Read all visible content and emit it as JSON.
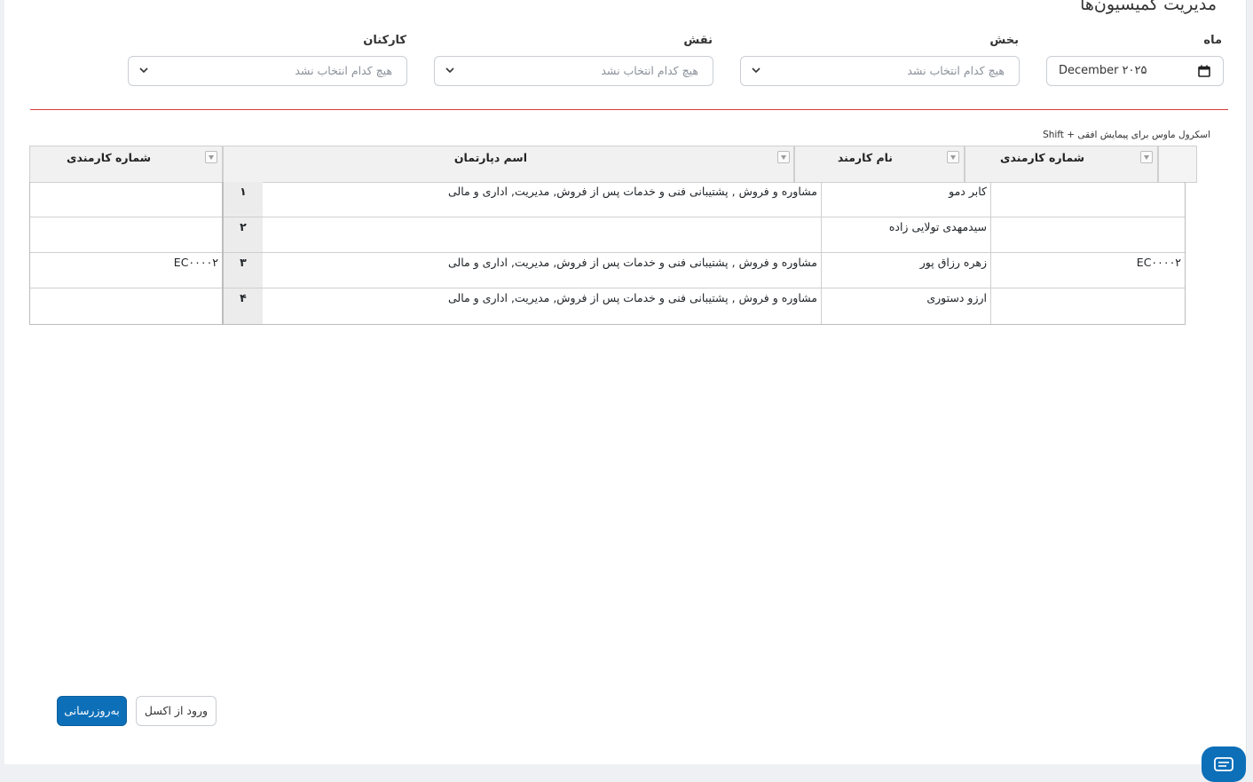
{
  "page": {
    "title": "مدیریت کمیسیون‌ها"
  },
  "filters": {
    "month": {
      "label": "ماه",
      "value": "December ۲۰۲۵"
    },
    "department": {
      "label": "بخش",
      "placeholder": "هیچ کدام انتخاب نشد"
    },
    "role": {
      "label": "نقش",
      "placeholder": "هیچ کدام انتخاب نشد"
    },
    "employees": {
      "label": "کارکنان",
      "placeholder": "هیچ کدام انتخاب نشد"
    }
  },
  "grid": {
    "scroll_hint": "Shift + اسکرول ماوس برای پیمایش افقی",
    "headers": {
      "employee_number": "شماره کارمندی",
      "employee_name": "نام کارمند",
      "department_name": "اسم دپارتمان",
      "employee_number_2": "شماره کارمندی"
    },
    "rows": [
      {
        "num": "۱",
        "employee_number": "",
        "employee_name": "کابر دمو",
        "department": "مشاوره و فروش , پشتیبانی فنی و خدمات پس از فروش, مدیریت, اداری و مالی",
        "employee_number_2": ""
      },
      {
        "num": "۲",
        "employee_number": "",
        "employee_name": "سیدمهدی تولایی زاده",
        "department": "",
        "employee_number_2": ""
      },
      {
        "num": "۳",
        "employee_number": "EC۰۰۰۰۲",
        "employee_name": "زهره رزاق پور",
        "department": "مشاوره و فروش , پشتیبانی فنی و خدمات پس از فروش, مدیریت, اداری و مالی",
        "employee_number_2": "EC۰۰۰۰۲"
      },
      {
        "num": "۴",
        "employee_number": "",
        "employee_name": "ارزو دستوری",
        "department": "مشاوره و فروش , پشتیبانی فنی و خدمات پس از فروش, مدیریت, اداری و مالی",
        "employee_number_2": ""
      }
    ]
  },
  "actions": {
    "refresh_label": "به‌روزرسانی",
    "import_excel_label": "ورود از اکسل"
  },
  "colors": {
    "primary": "#0d6fb8",
    "divider": "#d83a3a"
  },
  "icons": {
    "chat": "chat-icon",
    "calendar": "calendar-icon",
    "chevron": "chevron-down-icon",
    "filter": "filter-icon"
  }
}
